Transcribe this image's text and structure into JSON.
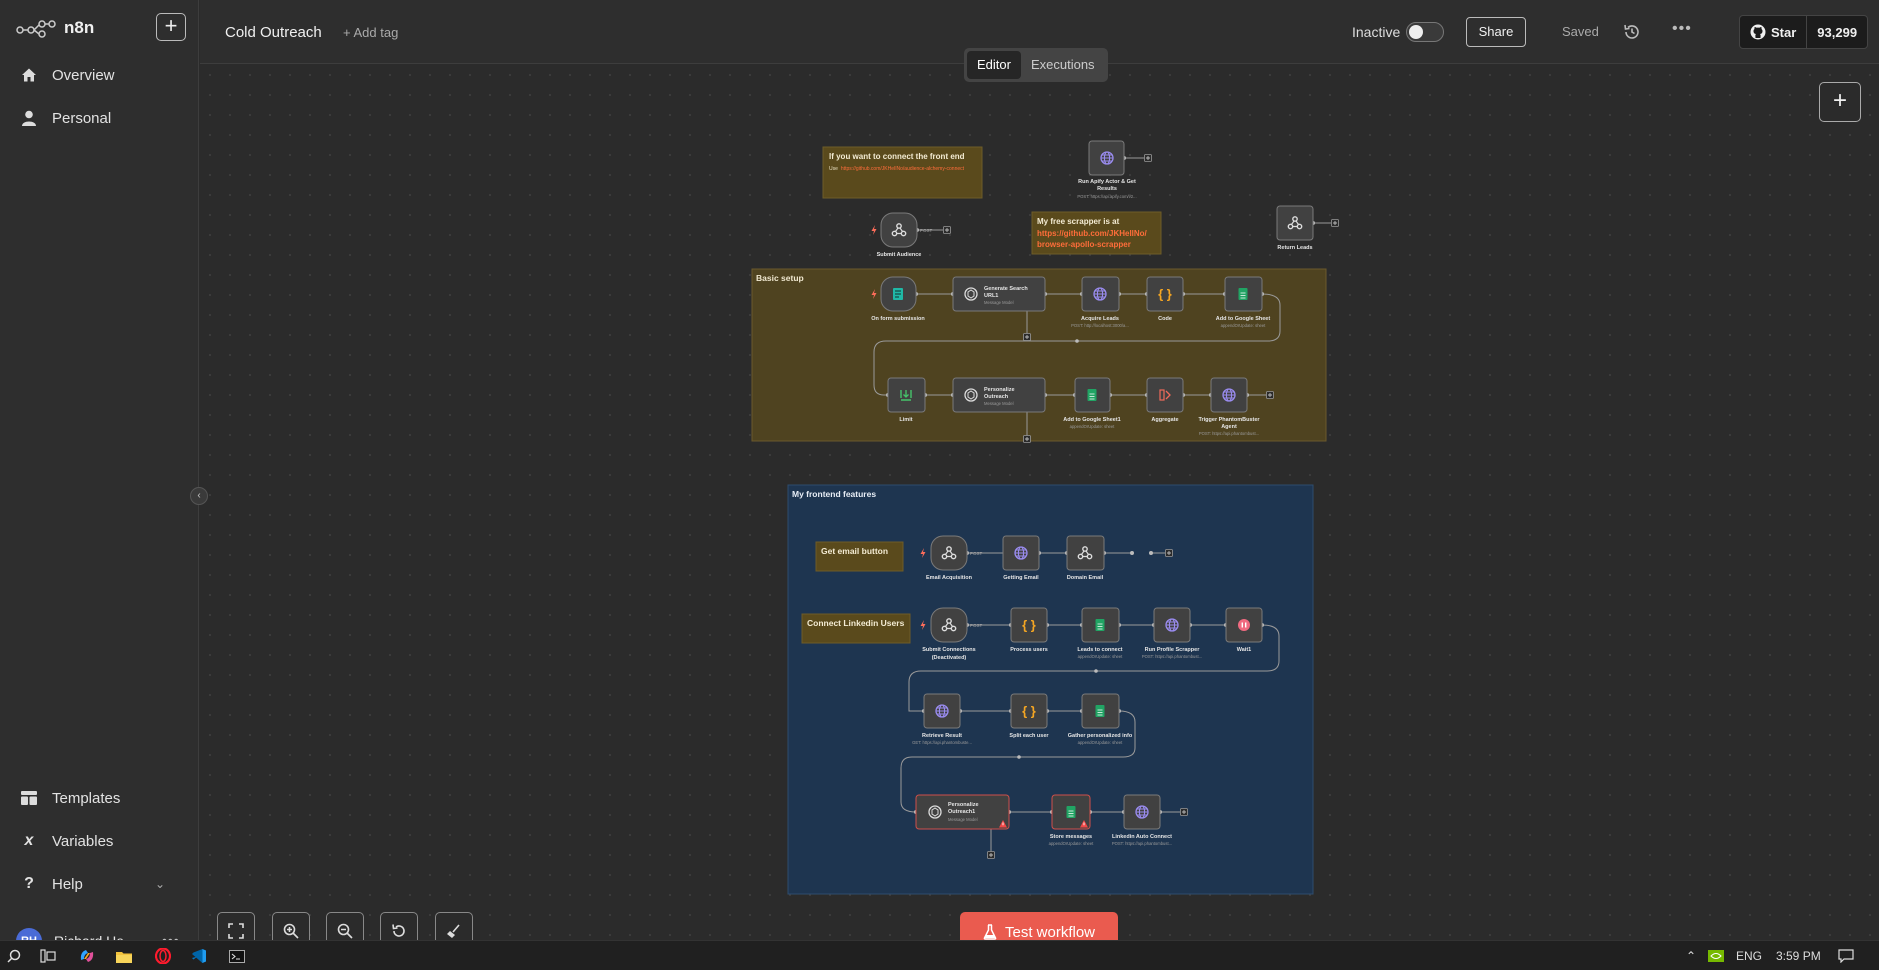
{
  "app": {
    "name": "n8n"
  },
  "sidebar": {
    "items": [
      {
        "label": "Overview"
      },
      {
        "label": "Personal"
      }
    ],
    "bottom_items": [
      {
        "label": "Templates"
      },
      {
        "label": "Variables"
      },
      {
        "label": "Help"
      }
    ],
    "user": {
      "initials": "RH",
      "name": "Richard He"
    }
  },
  "header": {
    "title": "Cold Outreach",
    "add_tag": "+ Add tag",
    "status": "Inactive",
    "share": "Share",
    "saved": "Saved",
    "github": {
      "star": "Star",
      "count": "93,299"
    }
  },
  "tabs": [
    {
      "label": "Editor",
      "active": true
    },
    {
      "label": "Executions",
      "active": false
    }
  ],
  "notes": {
    "front_end": {
      "title": "If you want to connect the front end",
      "prefix": "Use",
      "link": "https://github.com/JKHeIlNo/audience-alchemy-connect"
    },
    "scrapper": {
      "title": "My free scrapper is at",
      "link1": "https://github.com/JKHeIlNo/",
      "link2": "browser-apollo-scrapper"
    },
    "get_email": "Get email button",
    "linkedin": "Connect Linkedin Users"
  },
  "groups": {
    "basic": "Basic setup",
    "frontend": "My frontend features"
  },
  "nodes": {
    "run_apify": {
      "name1": "Run Apify Actor & Get",
      "name2": "Results",
      "sub": "POST: https://api.apify.com/v2..."
    },
    "submit_audience": {
      "name": "Submit Audience",
      "tag": "POST"
    },
    "return_leads": {
      "name": "Return Leads"
    },
    "on_form": {
      "name": "On form submission"
    },
    "gen_search": {
      "name1": "Generate Search",
      "name2": "URL1",
      "sub": "Message Model"
    },
    "acquire": {
      "name": "Acquire Leads",
      "sub": "POST: http://localhost:3000/a..."
    },
    "code": {
      "name": "Code"
    },
    "add_gs": {
      "name": "Add to Google Sheet",
      "sub": "appendOrUpdate: sheet"
    },
    "limit": {
      "name": "Limit"
    },
    "personalize": {
      "name1": "Personalize",
      "name2": "Outreach",
      "sub": "Message Model"
    },
    "add_gs1": {
      "name": "Add to Google Sheet1",
      "sub": "appendOrUpdate: sheet"
    },
    "aggregate": {
      "name": "Aggregate"
    },
    "trigger_pb": {
      "name1": "Trigger PhantomBuster",
      "name2": "Agent",
      "sub": "POST: https://api.phantombust..."
    },
    "email_acq": {
      "name": "Email Acquisition",
      "tag": "POST"
    },
    "getting_email": {
      "name": "Getting Email"
    },
    "domain_email": {
      "name": "Domain Email"
    },
    "submit_conn": {
      "name1": "Submit Connections",
      "name2": "(Deactivated)",
      "tag": "POST"
    },
    "process_users": {
      "name": "Process users"
    },
    "leads_connect": {
      "name": "Leads to connect",
      "sub": "appendOrUpdate: sheet"
    },
    "run_profile": {
      "name": "Run Profile Scrapper",
      "sub": "POST: https://api.phantombust..."
    },
    "wait1": {
      "name": "Wait1"
    },
    "retrieve": {
      "name": "Retrieve Result",
      "sub": "GET: https://api.phantombuste..."
    },
    "split": {
      "name": "Split each user"
    },
    "gather": {
      "name": "Gather personalized info",
      "sub": "appendOrUpdate: sheet"
    },
    "personalize1": {
      "name1": "Personalize",
      "name2": "Outreach1",
      "sub": "Message Model"
    },
    "store": {
      "name": "Store messages",
      "sub": "appendOrUpdate: sheet"
    },
    "li_auto": {
      "name": "Linkedin Auto Connect",
      "sub": "POST: https://api.phantombust..."
    }
  },
  "test_button": "Test workflow",
  "taskbar": {
    "lang": "ENG",
    "time": "3:59 PM"
  },
  "colors": {
    "accent": "#ea5b4f",
    "yellow_group": "#4f4320",
    "blue_group": "#1e3550",
    "note": "#5a4a1c",
    "link": "#ff6d3a"
  }
}
